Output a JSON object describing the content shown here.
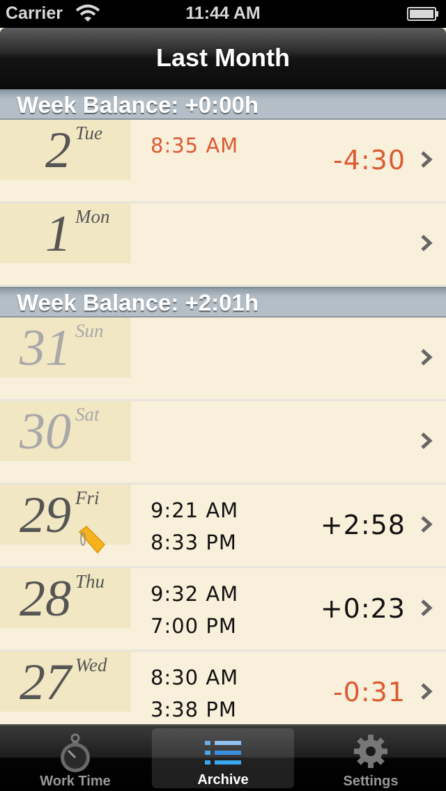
{
  "status_bar": {
    "carrier": "Carrier",
    "time": "11:44 AM"
  },
  "nav": {
    "title": "Last Month"
  },
  "sections": [
    {
      "header": "Week Balance: +0:00h",
      "rows": [
        {
          "day": "2",
          "weekday": "Tue",
          "times": [
            "8:35 AM"
          ],
          "time_color": "red",
          "balance": "-4:30",
          "balance_negative": true,
          "weekend": false,
          "tagged": false
        },
        {
          "day": "1",
          "weekday": "Mon",
          "times": [],
          "balance": "",
          "weekend": false,
          "tagged": false
        }
      ]
    },
    {
      "header": "Week Balance: +2:01h",
      "rows": [
        {
          "day": "31",
          "weekday": "Sun",
          "times": [],
          "balance": "",
          "weekend": true,
          "tagged": false
        },
        {
          "day": "30",
          "weekday": "Sat",
          "times": [],
          "balance": "",
          "weekend": true,
          "tagged": false
        },
        {
          "day": "29",
          "weekday": "Fri",
          "times": [
            "9:21 AM",
            "8:33 PM"
          ],
          "balance": "+2:58",
          "balance_negative": false,
          "weekend": false,
          "tagged": true
        },
        {
          "day": "28",
          "weekday": "Thu",
          "times": [
            "9:32 AM",
            "7:00 PM"
          ],
          "balance": "+0:23",
          "balance_negative": false,
          "weekend": false,
          "tagged": false
        },
        {
          "day": "27",
          "weekday": "Wed",
          "times": [
            "8:30 AM",
            "3:38 PM"
          ],
          "balance": "-0:31",
          "balance_negative": true,
          "weekend": false,
          "tagged": false
        }
      ]
    }
  ],
  "tabs": [
    {
      "label": "Work Time",
      "icon": "stopwatch-icon",
      "active": false
    },
    {
      "label": "Archive",
      "icon": "list-icon",
      "active": true
    },
    {
      "label": "Settings",
      "icon": "gear-icon",
      "active": false
    }
  ],
  "colors": {
    "negative": "#dc5a32",
    "positive": "#111111",
    "row_bg": "#f8f0da",
    "date_bg": "#f1e7c3"
  }
}
